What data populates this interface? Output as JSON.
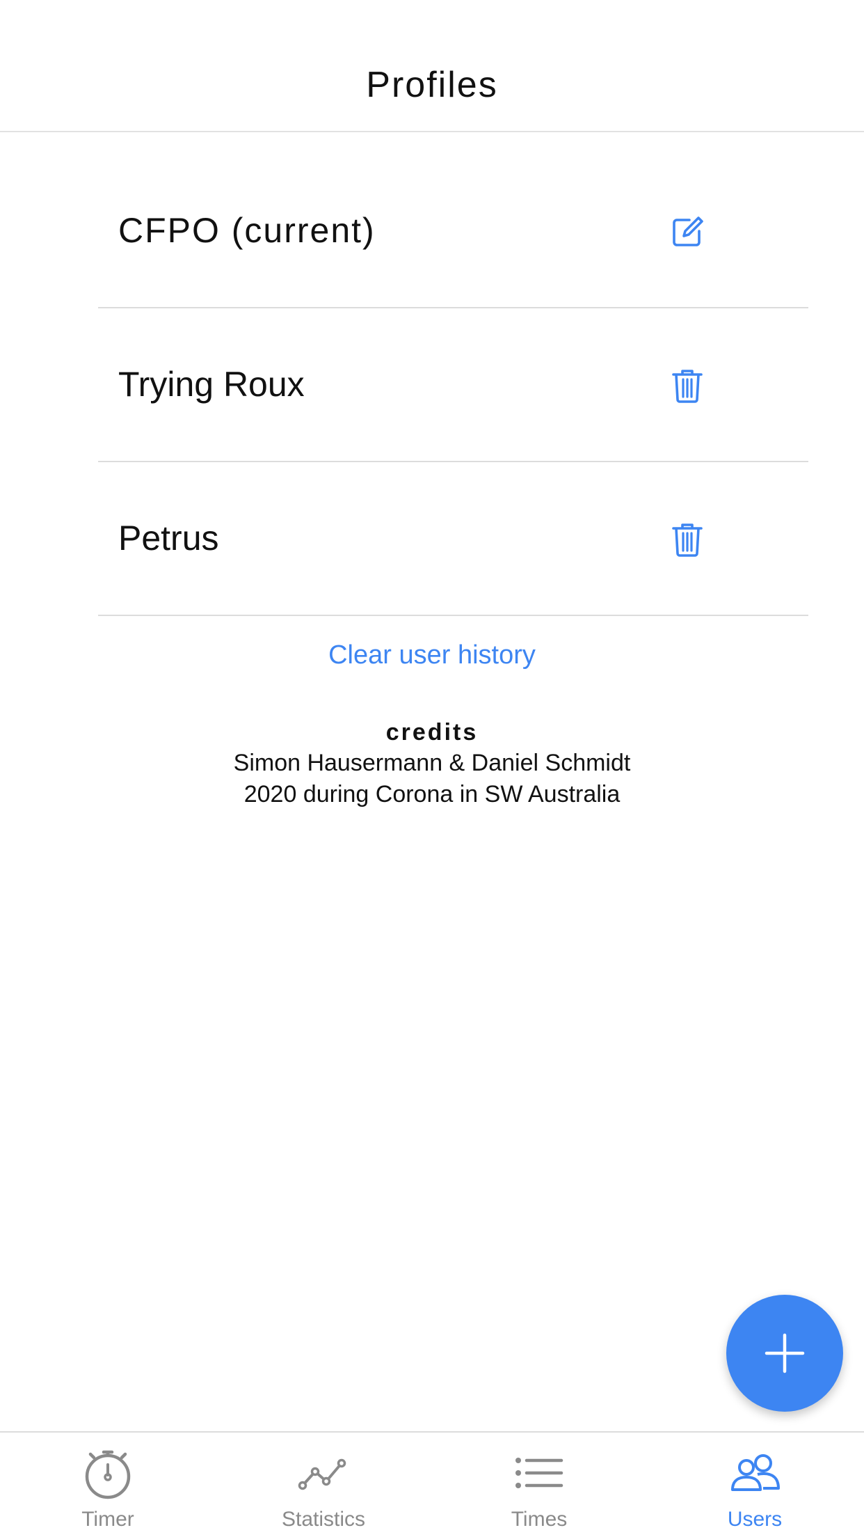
{
  "header": {
    "title": "Profiles"
  },
  "profiles": [
    {
      "name": "CFPO (current)",
      "action_icon": "edit-icon"
    },
    {
      "name": "Trying Roux",
      "action_icon": "trash-icon"
    },
    {
      "name": "Petrus",
      "action_icon": "trash-icon"
    }
  ],
  "clear_history_label": "Clear user history",
  "credits": {
    "title": "credits",
    "line1": "Simon Hausermann & Daniel Schmidt",
    "line2": "2020 during Corona in SW Australia"
  },
  "fab": {
    "icon": "plus-icon"
  },
  "tabs": [
    {
      "label": "Timer",
      "icon": "stopwatch-icon",
      "active": false
    },
    {
      "label": "Statistics",
      "icon": "line-chart-icon",
      "active": false
    },
    {
      "label": "Times",
      "icon": "list-icon",
      "active": false
    },
    {
      "label": "Users",
      "icon": "users-icon",
      "active": true
    }
  ],
  "colors": {
    "accent": "#3d85f2",
    "inactive": "#8a8a8a",
    "divider": "#dcdcdc"
  }
}
